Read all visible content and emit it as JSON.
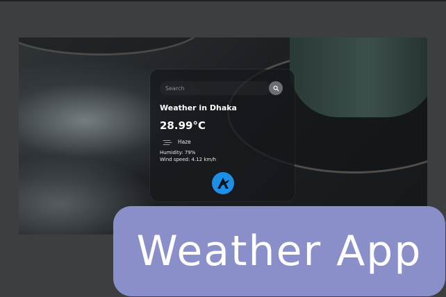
{
  "weather": {
    "search_placeholder": "Search",
    "title": "Weather in Dhaka",
    "temperature": "28.99°C",
    "description": "Haze",
    "humidity": "Humidity: 79%",
    "wind": "Wind speed: 4.12 km/h"
  },
  "banner": {
    "text": "Weather App"
  },
  "colors": {
    "page_bg": "#3d3e40",
    "banner_bg": "#8a8ec9",
    "logo_bg": "#1d8fe6"
  },
  "icons": [
    "search-icon",
    "haze-icon",
    "logo-icon"
  ]
}
